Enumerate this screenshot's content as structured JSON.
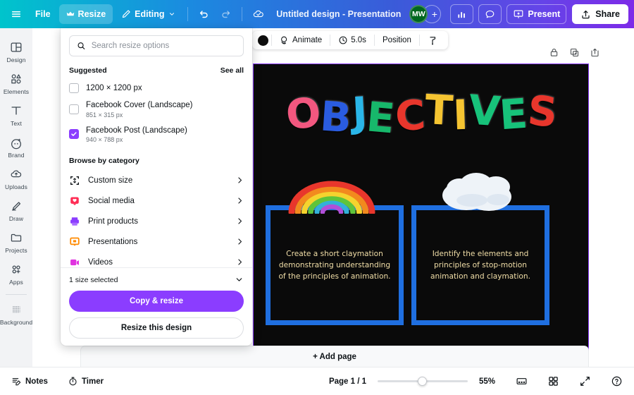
{
  "header": {
    "menu_icon": "hamburger-icon",
    "file_label": "File",
    "resize_label": "Resize",
    "editing_label": "Editing",
    "undo_icon": "undo-icon",
    "redo_icon": "redo-icon",
    "cloud_icon": "cloud-saved-icon",
    "doc_title": "Untitled design - Presentation",
    "avatar_initials": "MW",
    "add_collab_label": "+",
    "insights_icon": "insights-chart-icon",
    "comment_icon": "comment-bubble-icon",
    "present_label": "Present",
    "share_label": "Share"
  },
  "sidebar": {
    "items": [
      {
        "label": "Design",
        "icon": "design-layout-icon"
      },
      {
        "label": "Elements",
        "icon": "elements-shapes-icon"
      },
      {
        "label": "Text",
        "icon": "text-t-icon"
      },
      {
        "label": "Brand",
        "icon": "brand-crown-icon"
      },
      {
        "label": "Uploads",
        "icon": "upload-cloud-icon"
      },
      {
        "label": "Draw",
        "icon": "draw-pencil-icon"
      },
      {
        "label": "Projects",
        "icon": "projects-folder-icon"
      },
      {
        "label": "Apps",
        "icon": "apps-grid-icon"
      },
      {
        "label": "Background",
        "icon": "background-texture-icon"
      }
    ],
    "magic_icon": "magic-sparkle-icon"
  },
  "toolbar": {
    "color_swatch": "#0d0d0d",
    "animate_label": "Animate",
    "duration_label": "5.0s",
    "position_label": "Position",
    "transparency_icon": "transparency-icon"
  },
  "canvas_tools": {
    "lock_icon": "lock-icon",
    "duplicate_icon": "duplicate-icon",
    "export_icon": "export-icon"
  },
  "resize_panel": {
    "search_placeholder": "Search resize options",
    "search_value": "",
    "search_icon": "search-icon",
    "suggested_title": "Suggested",
    "see_all_label": "See all",
    "sizes": [
      {
        "name": "1200 × 1200 px",
        "dims": "",
        "checked": false
      },
      {
        "name": "Facebook Cover (Landscape)",
        "dims": "851 × 315 px",
        "checked": false
      },
      {
        "name": "Facebook Post (Landscape)",
        "dims": "940 × 788 px",
        "checked": true
      }
    ],
    "browse_title": "Browse by category",
    "categories": [
      {
        "name": "Custom size",
        "icon": "custom-size-icon",
        "color": "#0d1216"
      },
      {
        "name": "Social media",
        "icon": "social-media-icon",
        "color": "#ff2d55"
      },
      {
        "name": "Print products",
        "icon": "print-products-icon",
        "color": "#8b3dff"
      },
      {
        "name": "Presentations",
        "icon": "presentations-icon",
        "color": "#ff8a00"
      },
      {
        "name": "Videos",
        "icon": "videos-icon",
        "color": "#e033e0"
      }
    ],
    "selected_label": "1 size selected",
    "copy_resize_label": "Copy & resize",
    "resize_this_label": "Resize this design",
    "accent_color": "#8b3dff"
  },
  "slide": {
    "title_text": "OBJECTIVES",
    "title_letters": [
      {
        "ch": "O",
        "color": "#f2577f"
      },
      {
        "ch": "B",
        "color": "#2a5ce0"
      },
      {
        "ch": "J",
        "color": "#2ab6e8"
      },
      {
        "ch": "E",
        "color": "#17b86b"
      },
      {
        "ch": "C",
        "color": "#e8362c"
      },
      {
        "ch": "T",
        "color": "#f5c431"
      },
      {
        "ch": "I",
        "color": "#f5c431"
      },
      {
        "ch": "V",
        "color": "#17c27a"
      },
      {
        "ch": "E",
        "color": "#17c27a"
      },
      {
        "ch": "S",
        "color": "#e8362c"
      }
    ],
    "background_color": "#0a0a0a",
    "frame_color": "#1f6fe0",
    "text_color": "#f2dfa8",
    "boxes": [
      {
        "text": "Create a short claymation demonstrating understanding of the principles of animation.",
        "image": "clay-rainbow"
      },
      {
        "text": "Identify the elements and principles of stop-motion animation and claymation.",
        "image": "clay-cloud"
      }
    ]
  },
  "bottombar": {
    "notes_label": "Notes",
    "notes_icon": "notes-icon",
    "timer_label": "Timer",
    "timer_icon": "timer-icon",
    "add_page_label": "+ Add page",
    "page_label": "Page 1 / 1",
    "zoom_level": "55%",
    "grid_view_icon": "grid-view-icon",
    "pages_view_icon": "pages-view-icon",
    "fullscreen_icon": "fullscreen-icon",
    "help_icon": "help-icon"
  }
}
